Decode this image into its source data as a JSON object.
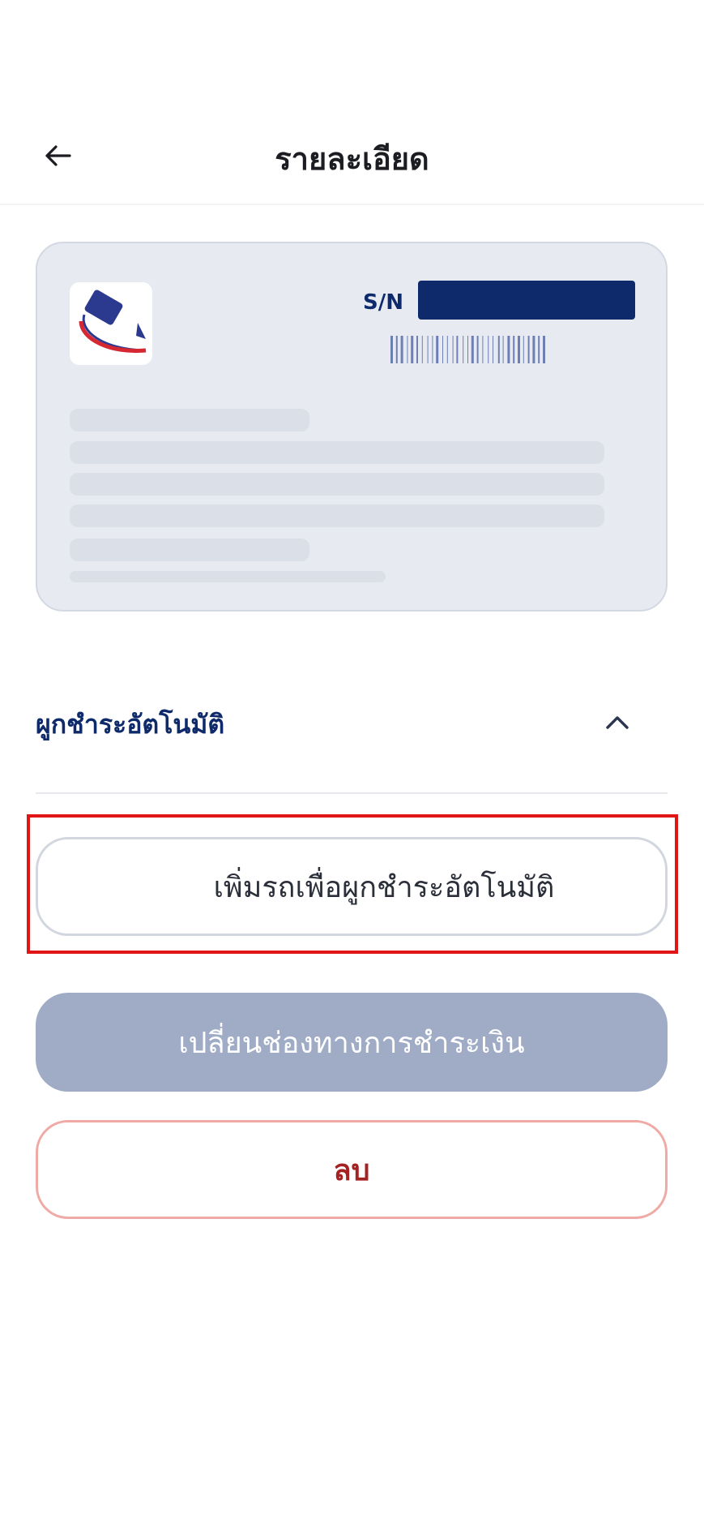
{
  "header": {
    "title": "รายละเอียด",
    "back_icon": "arrow-left-icon"
  },
  "card": {
    "logo_icon": "card-payment-logo",
    "sn_label": "S/N",
    "colors": {
      "background": "#e7eaf1",
      "accent": "#0f2a6b"
    }
  },
  "autopay": {
    "title": "ผูกชำระอัตโนมัติ",
    "toggle_icon": "chevron-up-icon"
  },
  "actions": {
    "add_vehicle_label": "เพิ่มรถเพื่อผูกชำระอัตโนมัติ",
    "change_payment_label": "เปลี่ยนช่องทางการชำระเงิน",
    "delete_label": "ลบ"
  },
  "colors": {
    "primary": "#0f2a6b",
    "disabled_button": "#a0acc5",
    "danger": "#a52222",
    "highlight": "#e01515"
  }
}
